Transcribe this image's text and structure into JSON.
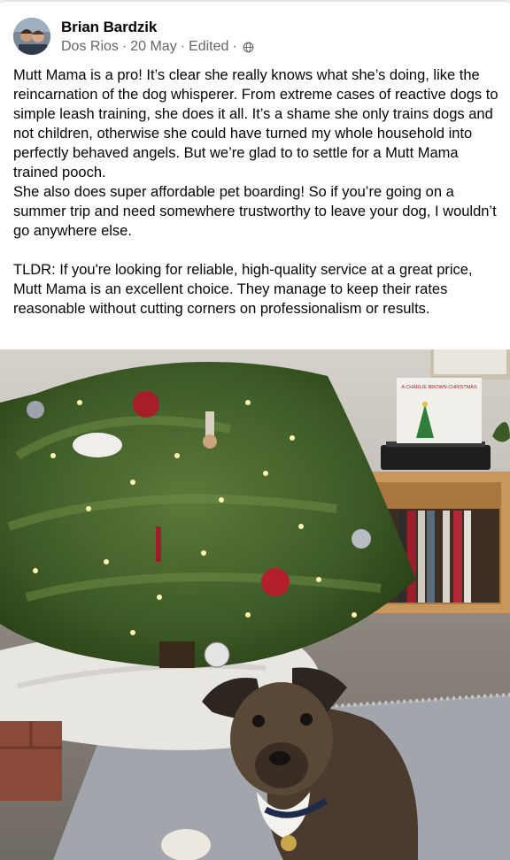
{
  "post": {
    "author": "Brian Bardzik",
    "location": "Dos Rios",
    "date": "20 May",
    "edited": "Edited",
    "privacy_icon": "globe-icon",
    "paragraphs": [
      "Mutt Mama is a pro! It’s clear she really knows what she’s doing, like the reincarnation of the dog whisperer. From extreme cases of reactive dogs to simple leash training, she does it all. It’s a shame she only trains dogs and not children, otherwise she could have turned my whole household into perfectly behaved angels. But we’re glad to to settle for a Mutt Mama trained pooch.",
      "She also does super affordable pet boarding! So if you’re going on a summer trip and need somewhere trustworthy to leave your dog, I wouldn’t go anywhere else.",
      "TLDR: If you're looking for reliable, high-quality service at a great price, Mutt Mama is an excellent choice. They manage to keep their rates reasonable without cutting corners on professionalism or results."
    ],
    "photo": {
      "record_label": "A CHARLIE BROWN CHRISTMAS"
    }
  },
  "colors": {
    "text": "#050505",
    "meta": "#65676b"
  }
}
